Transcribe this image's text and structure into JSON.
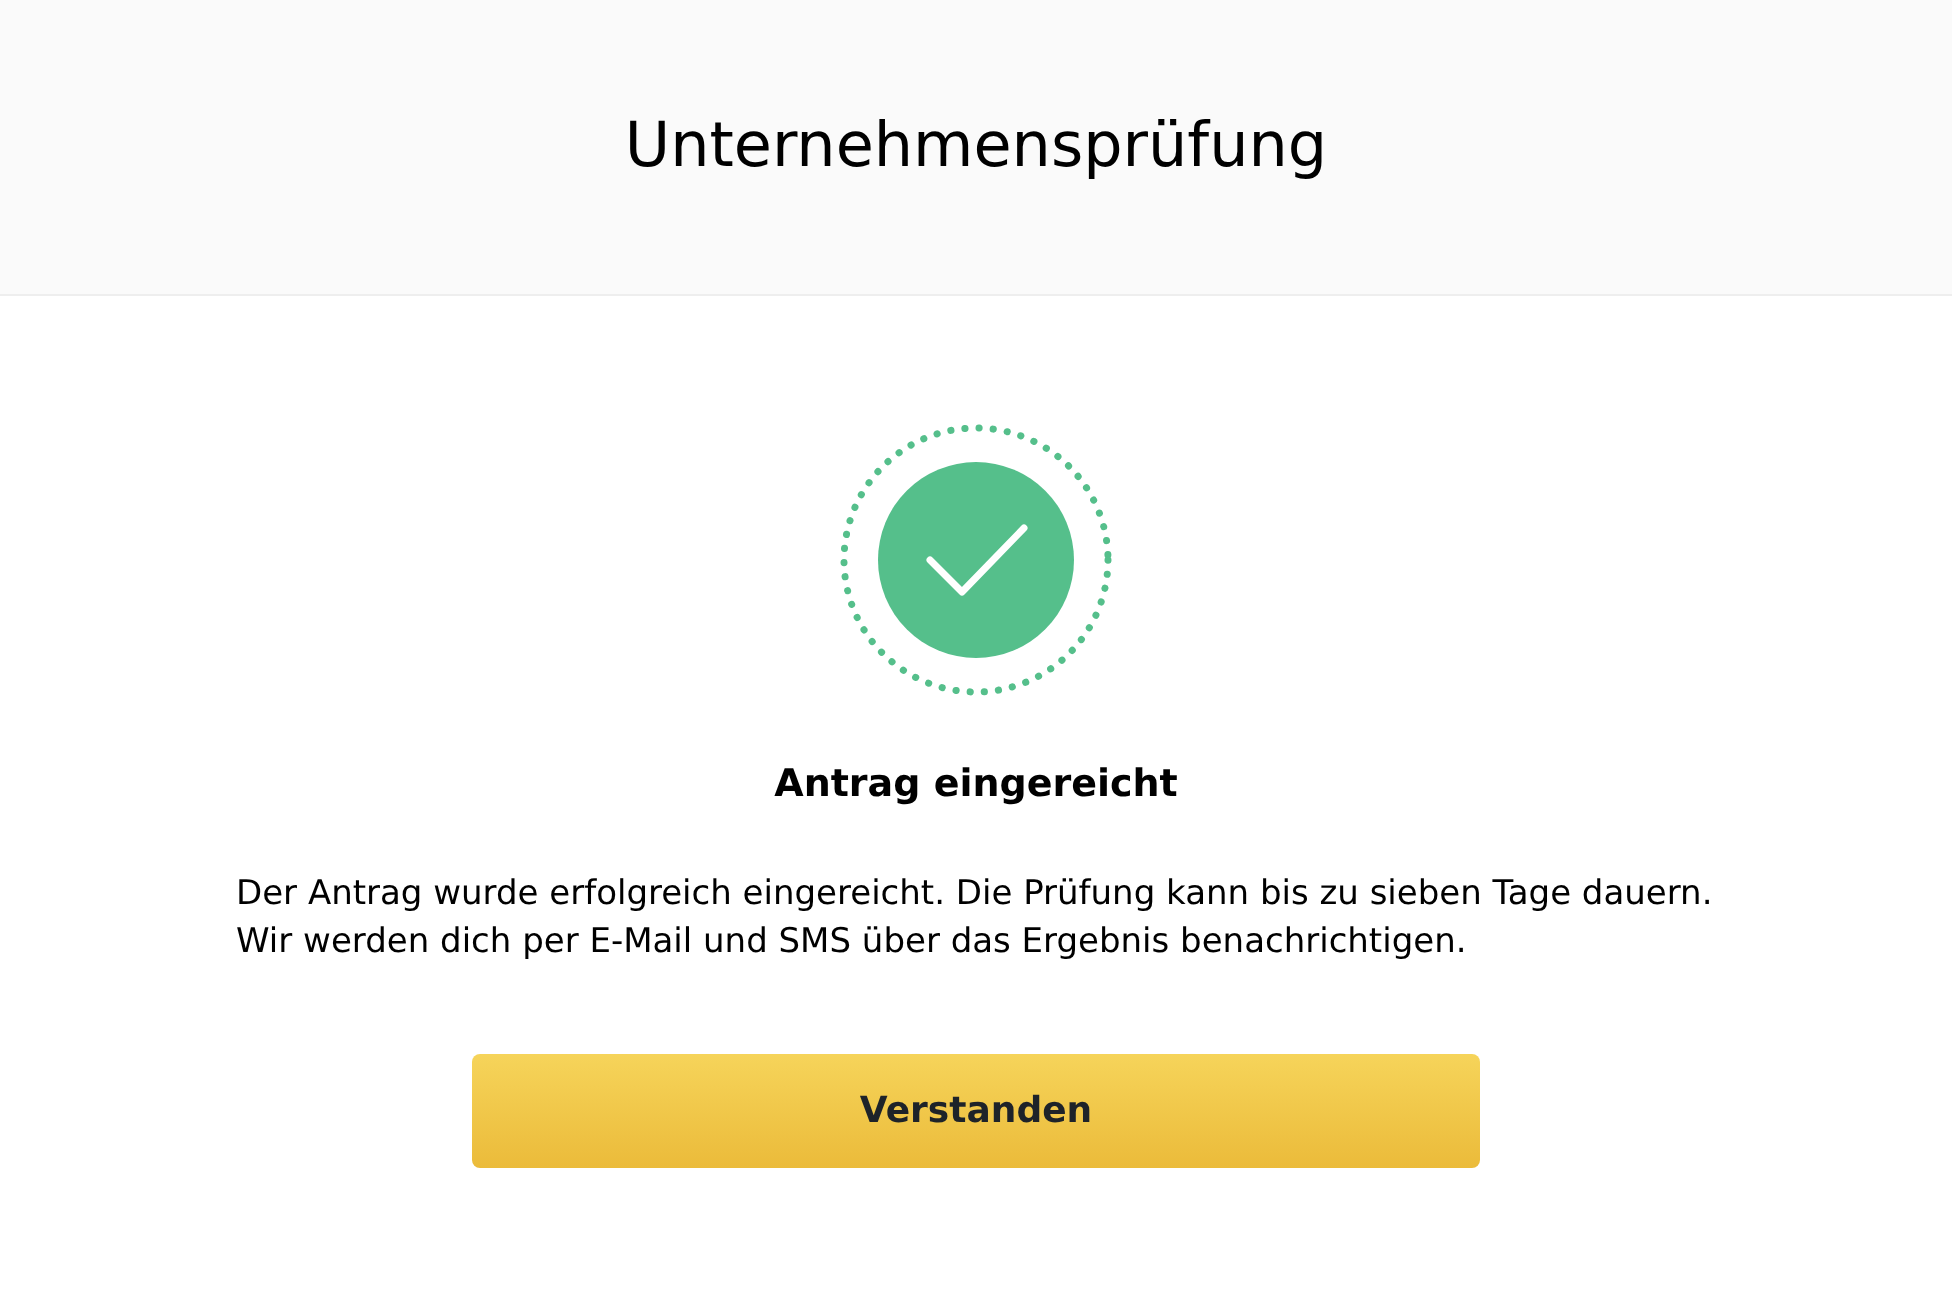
{
  "header": {
    "title": "Unternehmensprüfung"
  },
  "result": {
    "heading": "Antrag eingereicht",
    "message": "Der Antrag wurde erfolgreich eingereicht. Die Prüfung kann bis zu sieben Tage dauern. Wir werden dich per E-Mail und SMS über das Ergebnis benachrichtigen."
  },
  "buttons": [
    "Verstanden"
  ]
}
